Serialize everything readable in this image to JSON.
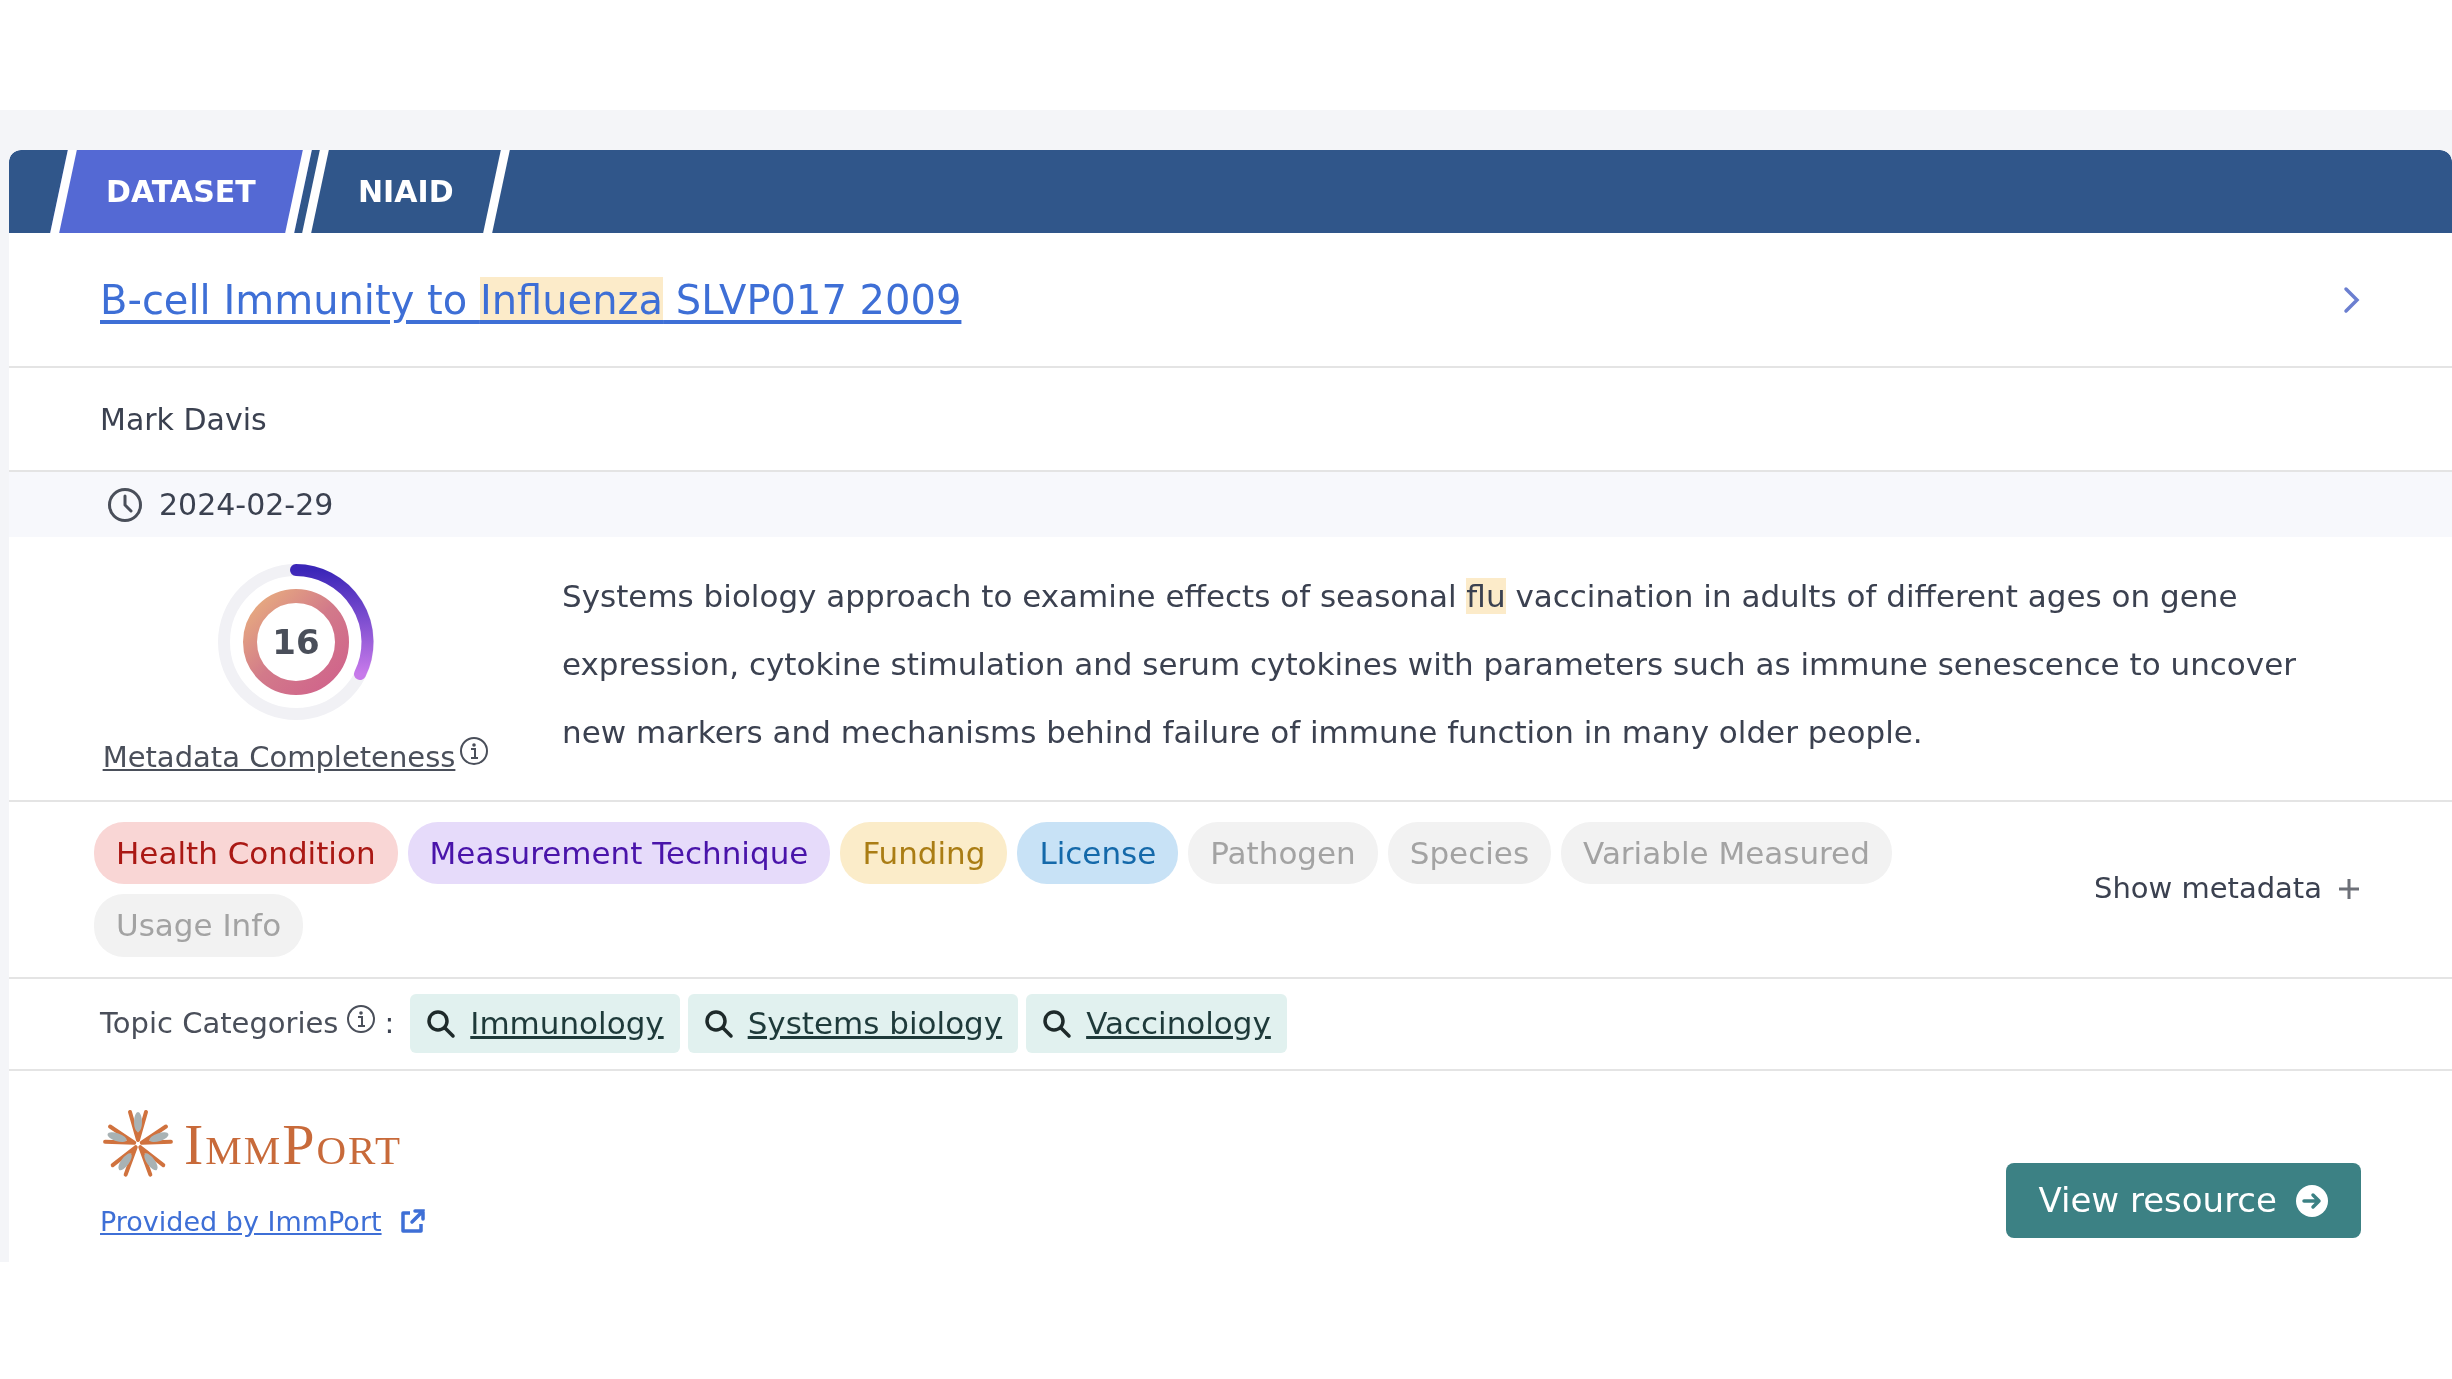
{
  "header_tags": [
    {
      "label": "DATASET",
      "color": "#5469d4"
    },
    {
      "label": "NIAID",
      "color": "#30568a"
    }
  ],
  "title": [
    {
      "text": "B-cell Immunity to ",
      "highlight": false
    },
    {
      "text": "Influenza",
      "highlight": true
    },
    {
      "text": " SLVP017 2009",
      "highlight": false
    }
  ],
  "author": "Mark Davis",
  "date": "2024-02-29",
  "completeness": {
    "score": "16",
    "label": "Metadata Completeness"
  },
  "description": [
    {
      "text": "Systems biology approach to examine effects of seasonal ",
      "highlight": false
    },
    {
      "text": "flu",
      "highlight": true
    },
    {
      "text": " vaccination in adults of different ages on gene expression, cytokine stimulation and serum cytokines with parameters such as immune senescence to uncover new markers and mechanisms behind failure of immune function in many older people.",
      "highlight": false
    }
  ],
  "metadata_tags": [
    {
      "label": "Health Condition",
      "color": "#f9d6d5",
      "disabled": false
    },
    {
      "label": "Measurement Technique",
      "color": "#e6dbfa",
      "disabled": false
    },
    {
      "label": "Funding",
      "color": "#fbecc9",
      "disabled": false
    },
    {
      "label": "License",
      "color": "#c8e2f6",
      "disabled": false
    },
    {
      "label": "Pathogen",
      "color": "#f2f2f2",
      "disabled": true
    },
    {
      "label": "Species",
      "color": "#f2f2f2",
      "disabled": true
    },
    {
      "label": "Variable Measured",
      "color": "#f2f2f2",
      "disabled": true
    },
    {
      "label": "Usage Info",
      "color": "#f2f2f2",
      "disabled": true
    }
  ],
  "show_metadata": "Show metadata",
  "topic_categories": {
    "label": "Topic Categories",
    "separator": ":",
    "items": [
      "Immunology",
      "Systems biology",
      "Vaccinology"
    ]
  },
  "source": {
    "logo_text": "ImmPort",
    "link": "Provided by ImmPort"
  },
  "view_button": "View resource"
}
